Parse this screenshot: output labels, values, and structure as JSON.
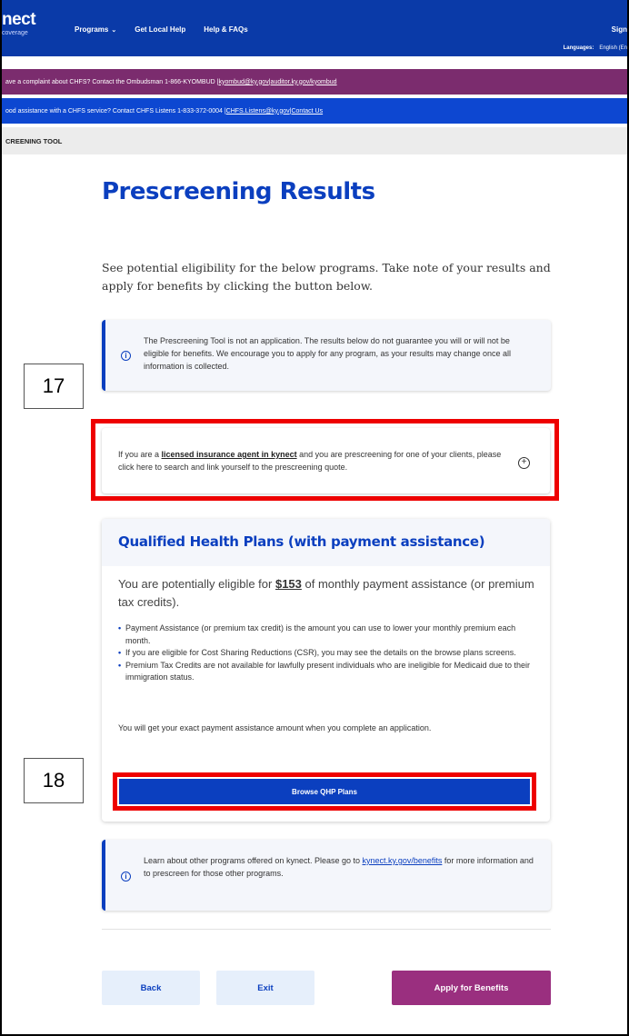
{
  "header": {
    "logo_main": "nect",
    "logo_sub": "coverage",
    "nav": [
      {
        "label": "Programs",
        "has_dropdown": true
      },
      {
        "label": "Get Local Help"
      },
      {
        "label": "Help & FAQs"
      }
    ],
    "signin": "Sign",
    "languages_label": "Languages:",
    "languages_value": "English (En"
  },
  "banners": {
    "ombudsman_text": "ave a complaint about CHFS? Contact the Ombudsman 1-866-KYOMBUD | ",
    "ombudsman_email": "kyombud@ky.gov",
    "ombudsman_sep": " | ",
    "ombudsman_link": "auditor.ky.gov/kyombud",
    "listens_text": "ood assistance with a CHFS service? Contact CHFS Listens 1-833-372-0004 | ",
    "listens_email": "CHFS.Listens@ky.gov",
    "listens_sep": " | ",
    "listens_link": "Contact Us"
  },
  "breadcrumb": "CREENING TOOL",
  "main": {
    "title": "Prescreening Results",
    "intro": "See potential eligibility for the below programs. Take note of your results and apply for benefits by clicking the button below.",
    "info_disclaimer": "The Prescreening Tool is not an application. The results below do not guarantee you will or will not be eligible for benefits. We encourage you to apply for any program, as your results may change once all information is collected.",
    "agent_prefix": "If you are a ",
    "agent_link": "licensed insurance agent in kynect",
    "agent_suffix": " and you are prescreening for one of your clients, please click here to search and link yourself to the prescreening quote.",
    "qhp": {
      "title": "Qualified Health Plans (with payment assistance)",
      "lead_prefix": "You are potentially eligible for ",
      "lead_amount": "$153",
      "lead_suffix": " of monthly payment assistance (or premium tax credits).",
      "bullets": [
        "Payment Assistance (or premium tax credit) is the amount you can use to lower your monthly premium each month.",
        "If you are eligible for Cost Sharing Reductions (CSR), you may see the details on the browse plans screens.",
        "Premium Tax Credits are not available for lawfully present individuals who are ineligible for Medicaid due to their immigration status."
      ],
      "note": "You will get your exact payment assistance amount when you complete an application.",
      "browse_button": "Browse QHP Plans"
    },
    "info_other_prefix": "Learn about other programs offered on kynect. Please go to ",
    "info_other_link": "kynect.ky.gov/benefits",
    "info_other_suffix": " for more information and to prescreen for those other programs."
  },
  "annotations": {
    "callout_17": "17",
    "callout_18": "18"
  },
  "footer": {
    "back": "Back",
    "exit": "Exit",
    "apply": "Apply for Benefits"
  },
  "icons": {
    "info": "info-circle-icon",
    "expand": "plus-circle-icon",
    "dropdown": "chevron-down-icon"
  },
  "colors": {
    "primary_blue": "#0b3fbf",
    "nav_blue": "#0a3aa8",
    "banner_purple": "#7b2c6e",
    "apply_purple": "#9a2f7f",
    "highlight_red": "#ee0000"
  }
}
